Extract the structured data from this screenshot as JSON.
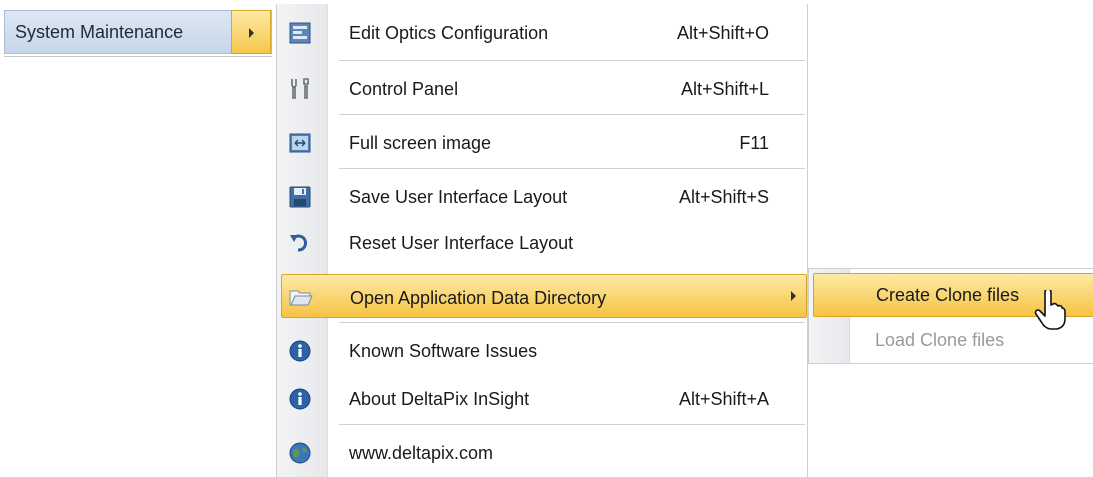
{
  "parent_menu": {
    "label": "System Maintenance"
  },
  "menu": {
    "items": [
      {
        "label": "Edit Optics Configuration",
        "shortcut": "Alt+Shift+O",
        "icon": "optics-config-icon"
      },
      {
        "label": "Control Panel",
        "shortcut": "Alt+Shift+L",
        "icon": "control-panel-icon"
      },
      {
        "label": "Full screen image",
        "shortcut": "F11",
        "icon": "fullscreen-icon"
      },
      {
        "label": "Save User Interface Layout",
        "shortcut": "Alt+Shift+S",
        "icon": "save-icon"
      },
      {
        "label": "Reset User Interface Layout",
        "shortcut": "",
        "icon": "undo-icon"
      },
      {
        "label": "Open Application Data Directory",
        "shortcut": "",
        "icon": "folder-open-icon"
      },
      {
        "label": "Known Software Issues",
        "shortcut": "",
        "icon": "info-icon"
      },
      {
        "label": "About DeltaPix InSight",
        "shortcut": "Alt+Shift+A",
        "icon": "info-icon"
      },
      {
        "label": "www.deltapix.com",
        "shortcut": "",
        "icon": "globe-icon"
      }
    ]
  },
  "submenu": {
    "items": [
      {
        "label": "Create Clone files",
        "state": "highlighted"
      },
      {
        "label": "Load Clone files",
        "state": "disabled"
      }
    ]
  },
  "colors": {
    "highlight": "#f6c343",
    "highlight_border": "#d8a52a",
    "parent_bg": "#c6d6ea",
    "disabled_text": "#9a9a9a"
  }
}
